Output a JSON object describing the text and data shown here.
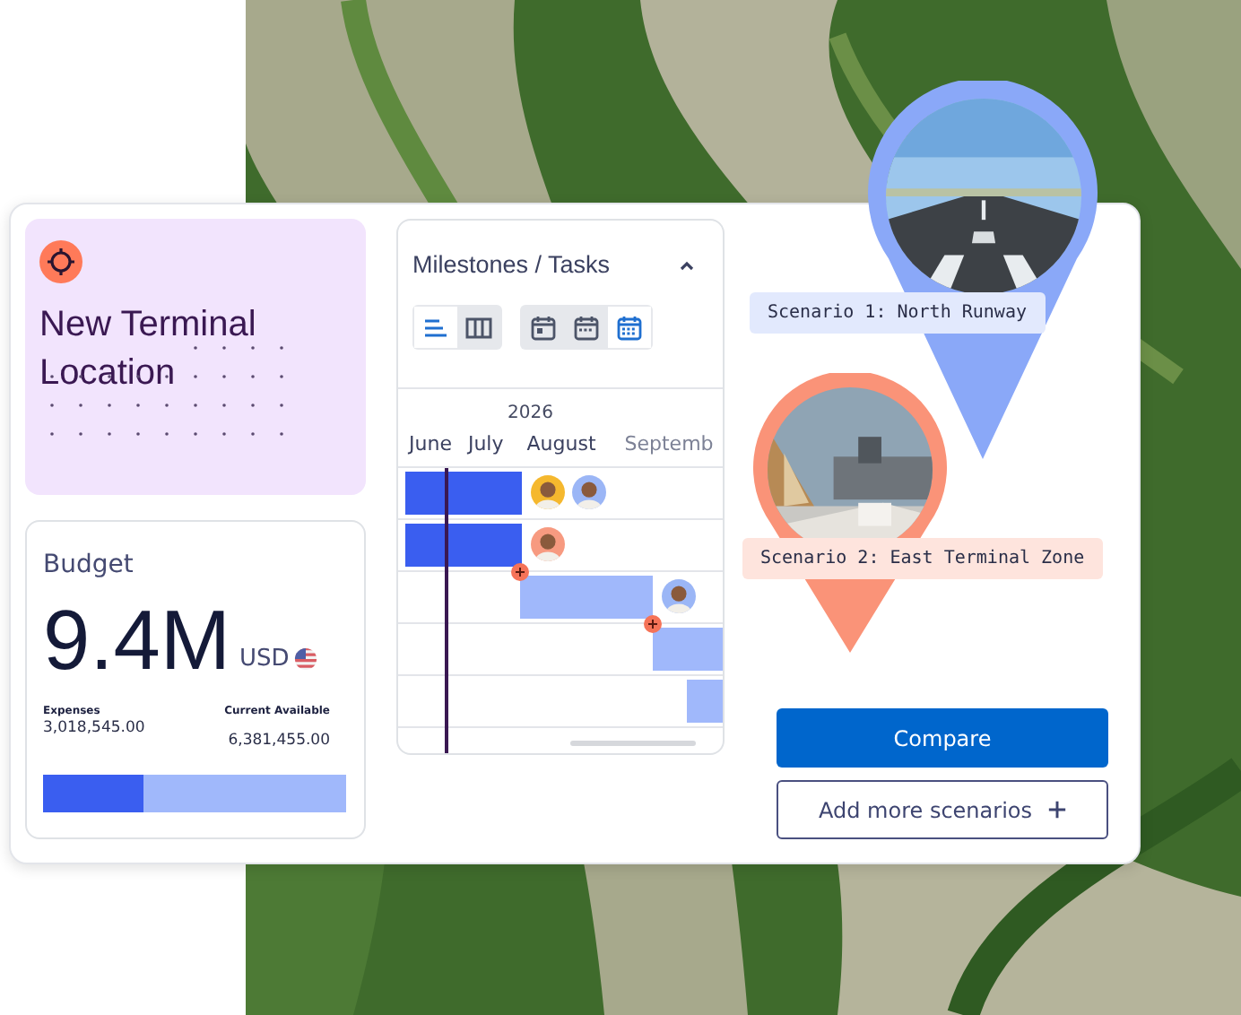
{
  "location": {
    "title": "New Terminal Location"
  },
  "budget": {
    "title": "Budget",
    "amount": "9.4M",
    "currency": "USD",
    "expenses_label": "Expenses",
    "expenses_value": "3,018,545.00",
    "available_label": "Current Available",
    "available_value": "6,381,455.00",
    "level": 0.33
  },
  "milestones": {
    "title": "Milestones / Tasks",
    "expanded": true,
    "view_modes": [
      {
        "kind": "list",
        "selected": true
      },
      {
        "kind": "columns",
        "selected": false
      }
    ],
    "scales": [
      {
        "kind": "day",
        "selected": false
      },
      {
        "kind": "week",
        "selected": false
      },
      {
        "kind": "month",
        "selected": true
      }
    ],
    "year": "2026",
    "months": [
      "June",
      "July",
      "August",
      "Septemb"
    ],
    "tasks": [
      {
        "kind": "done",
        "dependency": false,
        "assignees": [
          {
            "color": "#f5b82e"
          },
          {
            "color": "#9bb6f6"
          }
        ]
      },
      {
        "kind": "done",
        "dependency": false,
        "assignees": [
          {
            "color": "#f79a80"
          }
        ]
      },
      {
        "kind": "upcoming",
        "dependency": true,
        "assignees": [
          {
            "color": "#9bb6f6"
          }
        ]
      },
      {
        "kind": "upcoming",
        "dependency": true
      },
      {
        "kind": "upcoming",
        "dependency": false
      }
    ]
  },
  "scenarios": [
    {
      "label": "Scenario 1: North Runway",
      "color": "#8aa8f8",
      "kind": "runway"
    },
    {
      "label": "Scenario 2: East Terminal Zone",
      "color": "#fa9378",
      "kind": "terminal"
    }
  ],
  "buttons": [
    {
      "label": "Compare",
      "kind": "primary"
    },
    {
      "label": "Add more scenarios",
      "kind": "add"
    }
  ]
}
